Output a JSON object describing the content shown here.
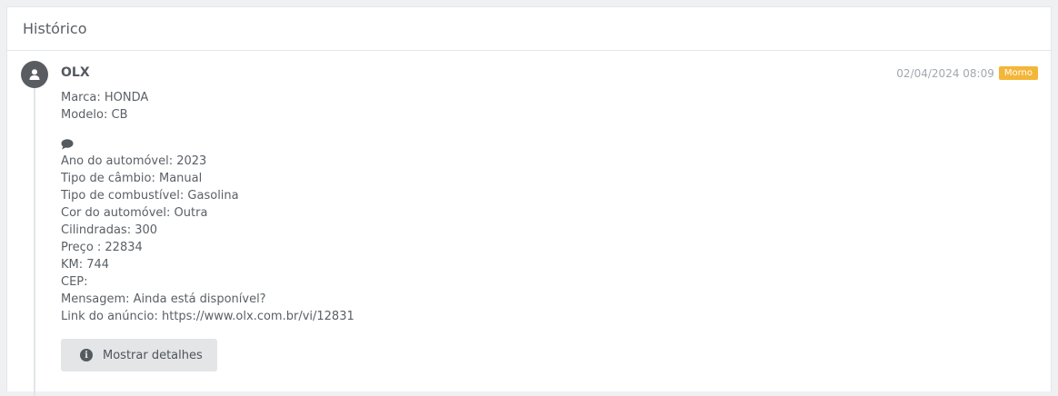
{
  "panel": {
    "title": "Histórico"
  },
  "entry": {
    "source": "OLX",
    "date": "02/04/2024 08:09",
    "badge": "Morno",
    "badge_color": "#f4b638",
    "summary": [
      "Marca: HONDA",
      "Modelo: CB"
    ],
    "comment_icon": "comment-icon",
    "details": [
      "Ano do automóvel: 2023",
      "Tipo de câmbio: Manual",
      "Tipo de combustível: Gasolina",
      "Cor do automóvel: Outra",
      "Cilindradas: 300",
      "Preço : 22834",
      "KM: 744",
      "CEP:",
      "Mensagem: Ainda está disponível?",
      "Link do anúncio: https://www.olx.com.br/vi/12831"
    ],
    "details_button_label": "Mostrar detalhes",
    "details_button_icon": "info-icon"
  }
}
